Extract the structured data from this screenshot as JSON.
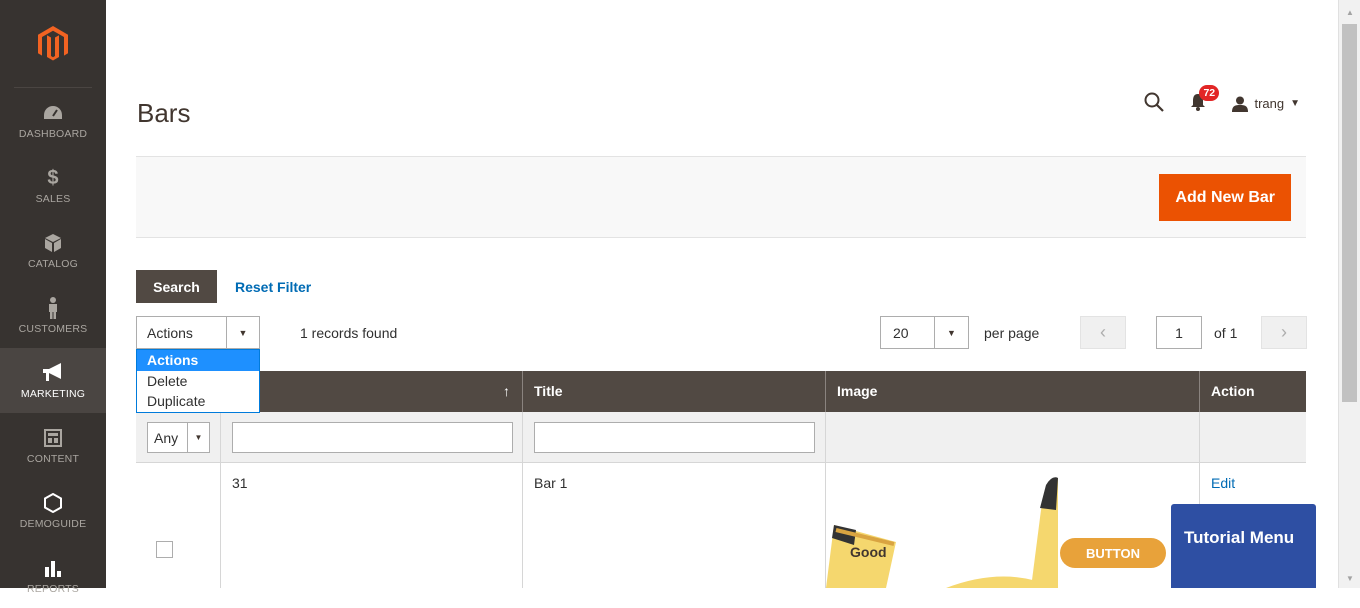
{
  "sidebar": {
    "items": [
      {
        "label": "DASHBOARD",
        "icon": "dashboard-icon"
      },
      {
        "label": "SALES",
        "icon": "dollar-icon"
      },
      {
        "label": "CATALOG",
        "icon": "cube-icon"
      },
      {
        "label": "CUSTOMERS",
        "icon": "person-icon"
      },
      {
        "label": "MARKETING",
        "icon": "megaphone-icon"
      },
      {
        "label": "CONTENT",
        "icon": "layout-icon"
      },
      {
        "label": "DEMOGUIDE",
        "icon": "hexagon-icon"
      },
      {
        "label": "REPORTS",
        "icon": "bar-chart-icon"
      }
    ]
  },
  "header": {
    "title": "Bars",
    "notification_count": "72",
    "user_name": "trang"
  },
  "page_actions": {
    "add_button": "Add New Bar"
  },
  "grid": {
    "search_label": "Search",
    "reset_label": "Reset Filter",
    "actions_value": "Actions",
    "actions_options": [
      "Actions",
      "Delete",
      "Duplicate"
    ],
    "records_found": "1 records found",
    "per_page_value": "20",
    "per_page_label": "per page",
    "current_page": "1",
    "page_of": "of 1",
    "columns": [
      "↑",
      "Title",
      "Image",
      "Action"
    ],
    "filter_any": "Any",
    "rows": [
      {
        "id": "31",
        "title": "Bar 1",
        "action": "Edit",
        "image_text": "Good",
        "image_button": "BUTTON"
      }
    ]
  },
  "tutorial_menu": "Tutorial Menu",
  "colors": {
    "accent": "#eb5202",
    "sidebar": "#373330",
    "table_header": "#514943",
    "link": "#006bb4"
  }
}
